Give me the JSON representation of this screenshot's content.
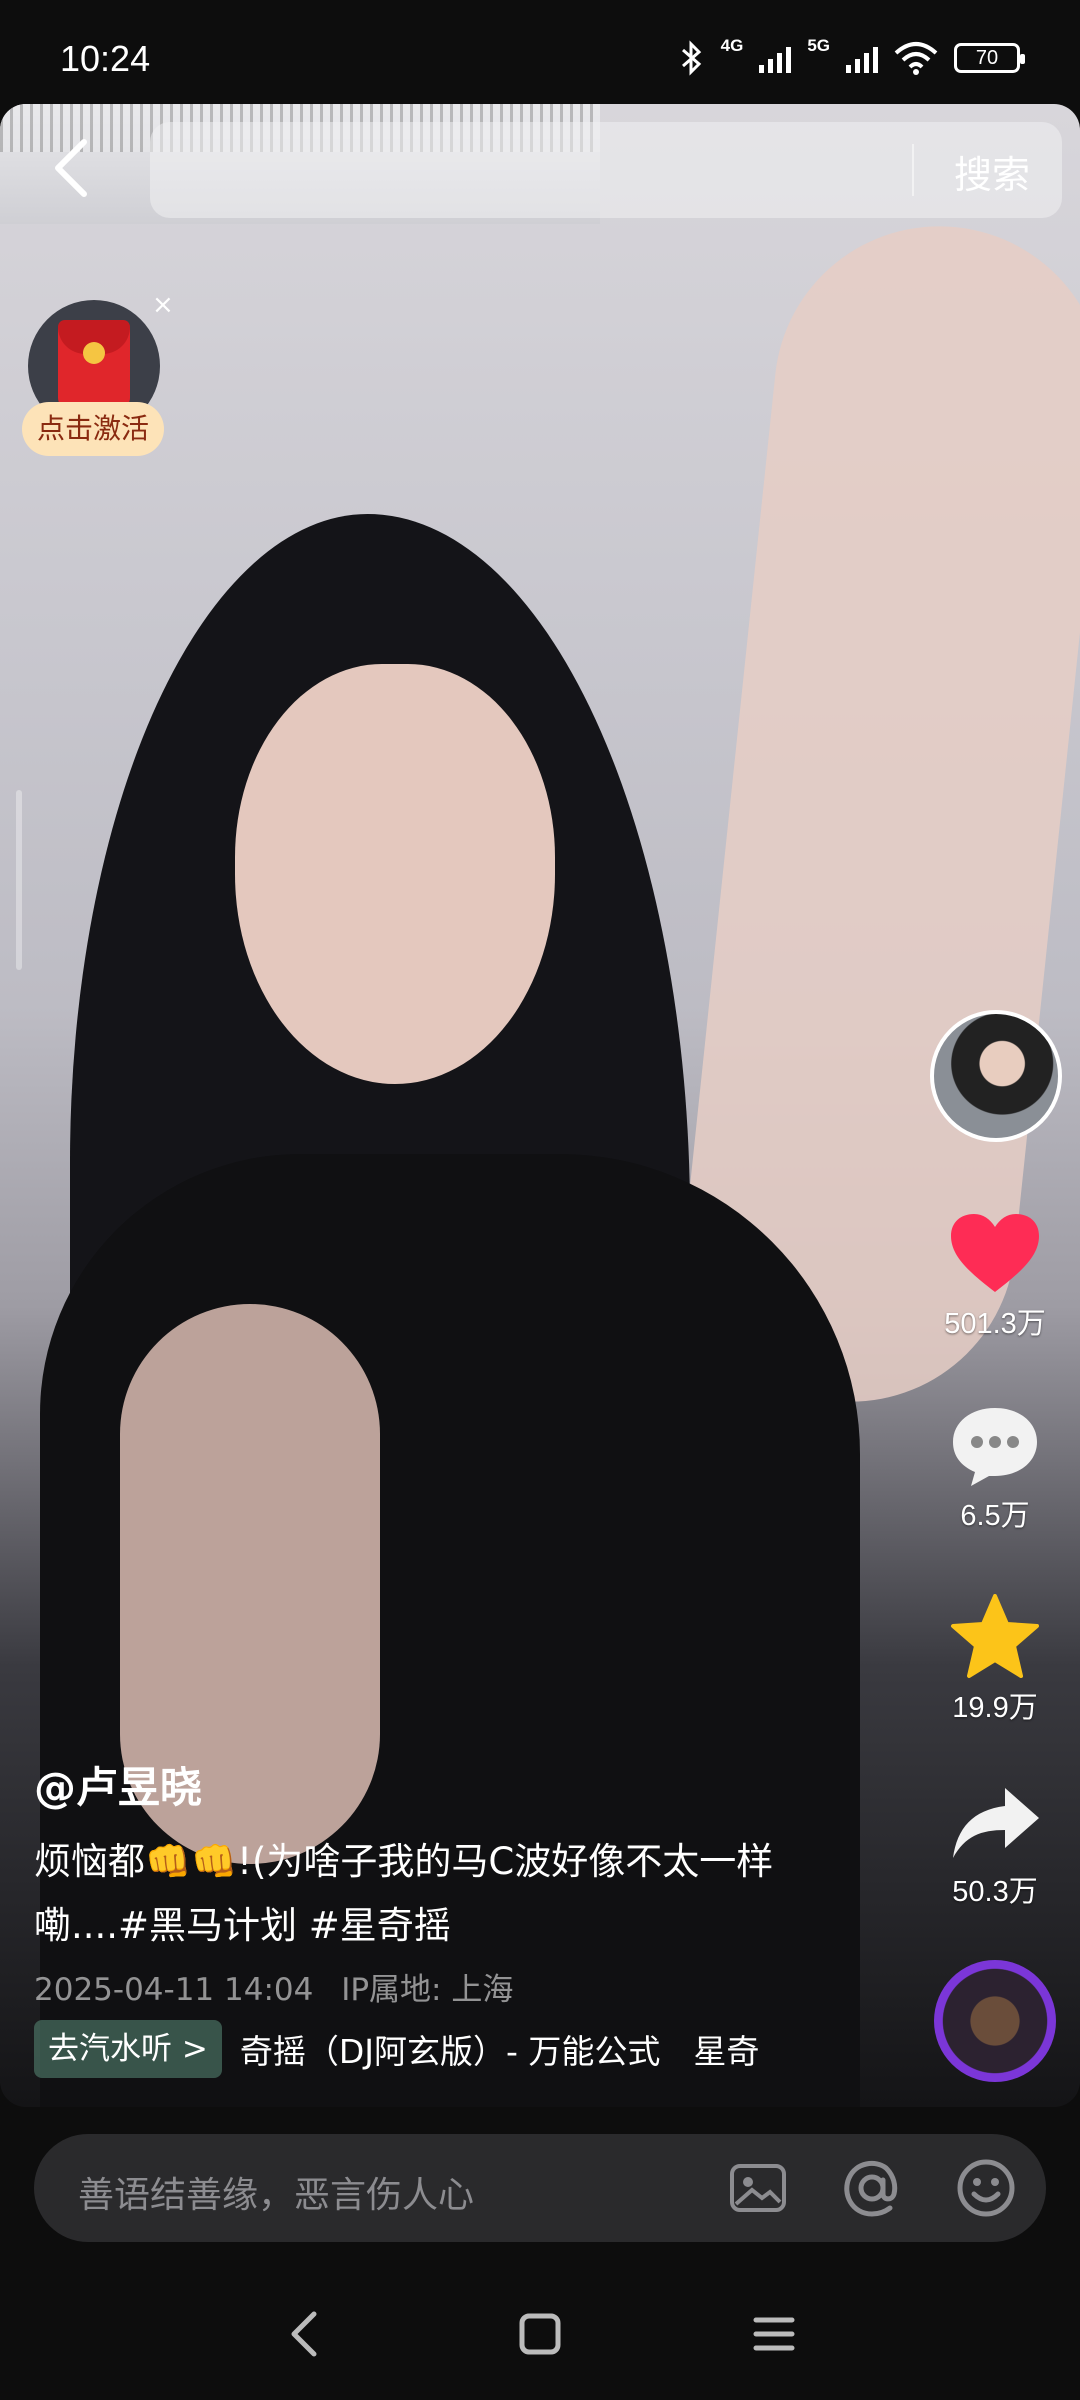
{
  "status_bar": {
    "time": "10:24",
    "network_1": "4G",
    "network_2": "5G",
    "battery": "70"
  },
  "search": {
    "placeholder": "",
    "button_label": "搜索"
  },
  "red_packet": {
    "label": "点击激活",
    "close_symbol": "×"
  },
  "actions": {
    "like_count": "501.3万",
    "comment_count": "6.5万",
    "favorite_count": "19.9万",
    "share_count": "50.3万"
  },
  "post": {
    "author": "@卢昱晓",
    "caption": "烦恼都👊👊!(为啥子我的马C波好像不太一样嘞....#黑马计划 #星奇摇",
    "timestamp": "2025-04-11 14:04",
    "ip_location": "IP属地: 上海"
  },
  "music": {
    "tag_label": "去汽水听 >",
    "title": "奇摇（DJ阿玄版）- 万能公式　星奇"
  },
  "comment_bar": {
    "placeholder": "善语结善缘，恶言伤人心"
  },
  "colors": {
    "like": "#fe2c55",
    "favorite": "#fcc419",
    "red_packet_label_bg": "#fde3b8"
  }
}
